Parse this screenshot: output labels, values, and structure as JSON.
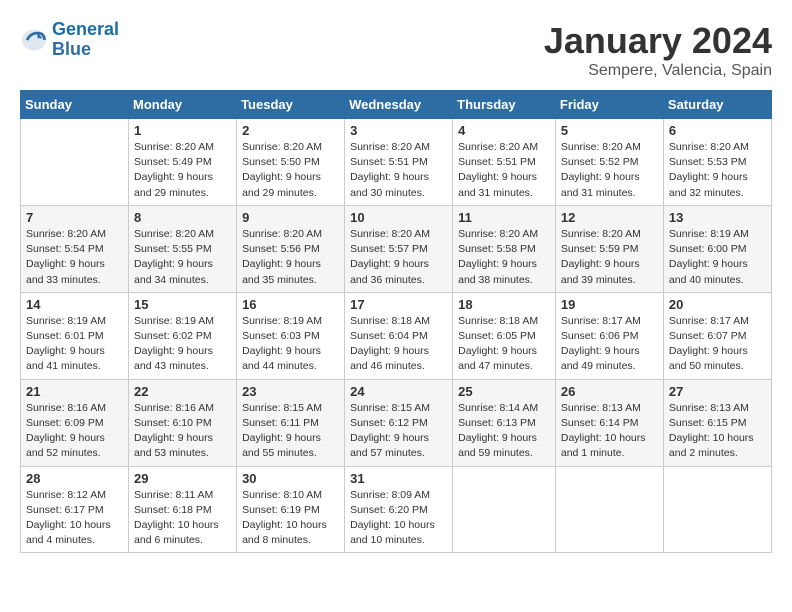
{
  "logo": {
    "line1": "General",
    "line2": "Blue"
  },
  "title": "January 2024",
  "subtitle": "Sempere, Valencia, Spain",
  "days_header": [
    "Sunday",
    "Monday",
    "Tuesday",
    "Wednesday",
    "Thursday",
    "Friday",
    "Saturday"
  ],
  "weeks": [
    [
      {
        "num": "",
        "info": ""
      },
      {
        "num": "1",
        "info": "Sunrise: 8:20 AM\nSunset: 5:49 PM\nDaylight: 9 hours\nand 29 minutes."
      },
      {
        "num": "2",
        "info": "Sunrise: 8:20 AM\nSunset: 5:50 PM\nDaylight: 9 hours\nand 29 minutes."
      },
      {
        "num": "3",
        "info": "Sunrise: 8:20 AM\nSunset: 5:51 PM\nDaylight: 9 hours\nand 30 minutes."
      },
      {
        "num": "4",
        "info": "Sunrise: 8:20 AM\nSunset: 5:51 PM\nDaylight: 9 hours\nand 31 minutes."
      },
      {
        "num": "5",
        "info": "Sunrise: 8:20 AM\nSunset: 5:52 PM\nDaylight: 9 hours\nand 31 minutes."
      },
      {
        "num": "6",
        "info": "Sunrise: 8:20 AM\nSunset: 5:53 PM\nDaylight: 9 hours\nand 32 minutes."
      }
    ],
    [
      {
        "num": "7",
        "info": "Sunrise: 8:20 AM\nSunset: 5:54 PM\nDaylight: 9 hours\nand 33 minutes."
      },
      {
        "num": "8",
        "info": "Sunrise: 8:20 AM\nSunset: 5:55 PM\nDaylight: 9 hours\nand 34 minutes."
      },
      {
        "num": "9",
        "info": "Sunrise: 8:20 AM\nSunset: 5:56 PM\nDaylight: 9 hours\nand 35 minutes."
      },
      {
        "num": "10",
        "info": "Sunrise: 8:20 AM\nSunset: 5:57 PM\nDaylight: 9 hours\nand 36 minutes."
      },
      {
        "num": "11",
        "info": "Sunrise: 8:20 AM\nSunset: 5:58 PM\nDaylight: 9 hours\nand 38 minutes."
      },
      {
        "num": "12",
        "info": "Sunrise: 8:20 AM\nSunset: 5:59 PM\nDaylight: 9 hours\nand 39 minutes."
      },
      {
        "num": "13",
        "info": "Sunrise: 8:19 AM\nSunset: 6:00 PM\nDaylight: 9 hours\nand 40 minutes."
      }
    ],
    [
      {
        "num": "14",
        "info": "Sunrise: 8:19 AM\nSunset: 6:01 PM\nDaylight: 9 hours\nand 41 minutes."
      },
      {
        "num": "15",
        "info": "Sunrise: 8:19 AM\nSunset: 6:02 PM\nDaylight: 9 hours\nand 43 minutes."
      },
      {
        "num": "16",
        "info": "Sunrise: 8:19 AM\nSunset: 6:03 PM\nDaylight: 9 hours\nand 44 minutes."
      },
      {
        "num": "17",
        "info": "Sunrise: 8:18 AM\nSunset: 6:04 PM\nDaylight: 9 hours\nand 46 minutes."
      },
      {
        "num": "18",
        "info": "Sunrise: 8:18 AM\nSunset: 6:05 PM\nDaylight: 9 hours\nand 47 minutes."
      },
      {
        "num": "19",
        "info": "Sunrise: 8:17 AM\nSunset: 6:06 PM\nDaylight: 9 hours\nand 49 minutes."
      },
      {
        "num": "20",
        "info": "Sunrise: 8:17 AM\nSunset: 6:07 PM\nDaylight: 9 hours\nand 50 minutes."
      }
    ],
    [
      {
        "num": "21",
        "info": "Sunrise: 8:16 AM\nSunset: 6:09 PM\nDaylight: 9 hours\nand 52 minutes."
      },
      {
        "num": "22",
        "info": "Sunrise: 8:16 AM\nSunset: 6:10 PM\nDaylight: 9 hours\nand 53 minutes."
      },
      {
        "num": "23",
        "info": "Sunrise: 8:15 AM\nSunset: 6:11 PM\nDaylight: 9 hours\nand 55 minutes."
      },
      {
        "num": "24",
        "info": "Sunrise: 8:15 AM\nSunset: 6:12 PM\nDaylight: 9 hours\nand 57 minutes."
      },
      {
        "num": "25",
        "info": "Sunrise: 8:14 AM\nSunset: 6:13 PM\nDaylight: 9 hours\nand 59 minutes."
      },
      {
        "num": "26",
        "info": "Sunrise: 8:13 AM\nSunset: 6:14 PM\nDaylight: 10 hours\nand 1 minute."
      },
      {
        "num": "27",
        "info": "Sunrise: 8:13 AM\nSunset: 6:15 PM\nDaylight: 10 hours\nand 2 minutes."
      }
    ],
    [
      {
        "num": "28",
        "info": "Sunrise: 8:12 AM\nSunset: 6:17 PM\nDaylight: 10 hours\nand 4 minutes."
      },
      {
        "num": "29",
        "info": "Sunrise: 8:11 AM\nSunset: 6:18 PM\nDaylight: 10 hours\nand 6 minutes."
      },
      {
        "num": "30",
        "info": "Sunrise: 8:10 AM\nSunset: 6:19 PM\nDaylight: 10 hours\nand 8 minutes."
      },
      {
        "num": "31",
        "info": "Sunrise: 8:09 AM\nSunset: 6:20 PM\nDaylight: 10 hours\nand 10 minutes."
      },
      {
        "num": "",
        "info": ""
      },
      {
        "num": "",
        "info": ""
      },
      {
        "num": "",
        "info": ""
      }
    ]
  ]
}
